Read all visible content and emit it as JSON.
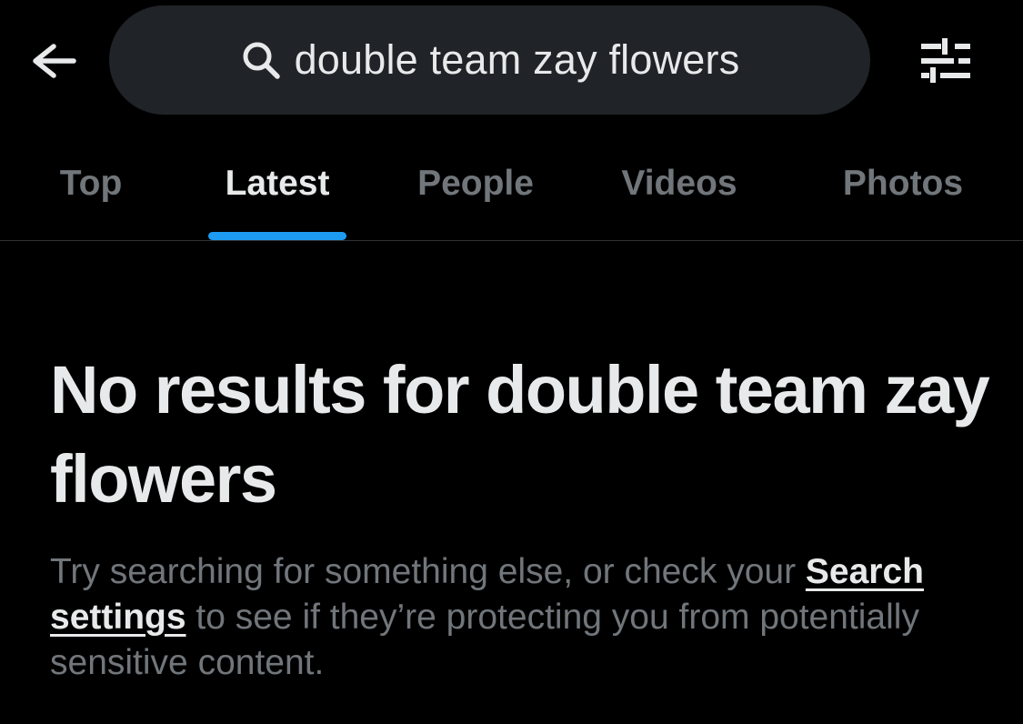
{
  "header": {
    "back_icon": "arrow-left-icon",
    "search": {
      "icon": "search-icon",
      "query": "double team zay flowers"
    },
    "filter_icon": "sliders-icon"
  },
  "tabs": [
    {
      "label": "Top",
      "active": false
    },
    {
      "label": "Latest",
      "active": true
    },
    {
      "label": "People",
      "active": false
    },
    {
      "label": "Videos",
      "active": false
    },
    {
      "label": "Photos",
      "active": false
    }
  ],
  "empty_state": {
    "title": "No results for double team zay flowers",
    "body_before_link": "Try searching for something else, or check your ",
    "link_label": "Search settings",
    "body_after_link": " to see if they’re protecting you from potentially sensitive content."
  },
  "colors": {
    "background": "#000000",
    "search_pill": "#202327",
    "primary_text": "#e7e9ea",
    "secondary_text": "#71767b",
    "accent": "#1d9bf0",
    "divider": "#2f3336"
  }
}
